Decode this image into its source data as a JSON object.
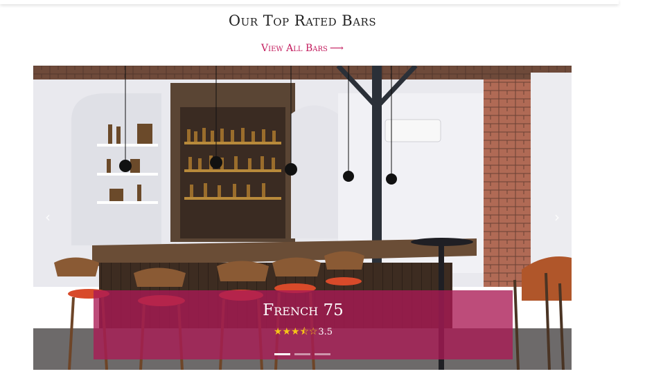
{
  "section": {
    "title": "Our Top Rated Bars",
    "view_all_label": "View All Bars",
    "view_all_icon": "arrow-right-icon"
  },
  "carousel": {
    "prev_icon": "chevron-left-icon",
    "next_icon": "chevron-right-icon",
    "prev_glyph": "‹",
    "next_glyph": "›",
    "slide_count": 3,
    "active_slide": 1,
    "current": {
      "name": "French 75",
      "rating_value": "3.5",
      "rating": 3.5,
      "rating_max": 5,
      "star_color": "#f5c518"
    }
  },
  "colors": {
    "accent": "#c2185b",
    "caption_bg": "#aa1955"
  }
}
